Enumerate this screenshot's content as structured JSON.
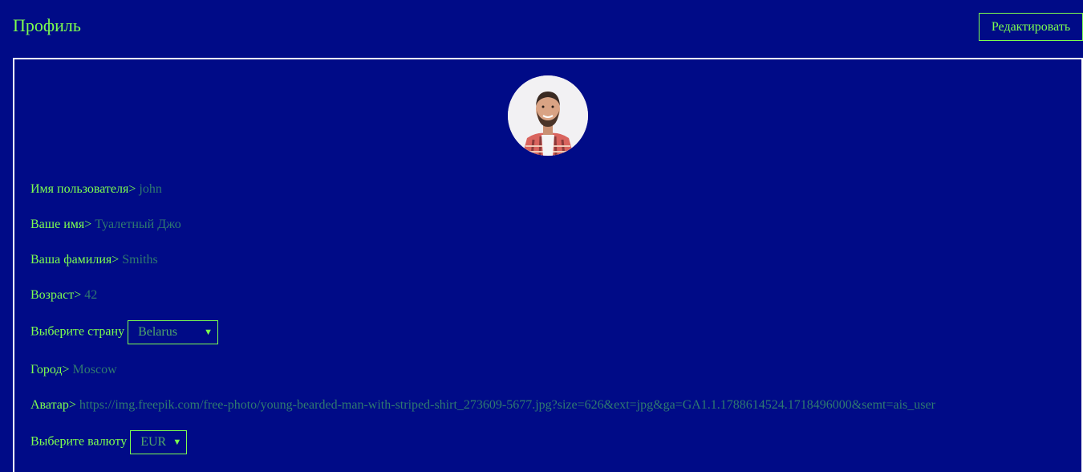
{
  "header": {
    "title": "Профиль",
    "edit_label": "Редактировать"
  },
  "profile": {
    "username_label": "Имя пользователя>",
    "username": "john",
    "firstname_label": "Ваше имя>",
    "firstname": "Туалетный Джо",
    "lastname_label": "Ваша фамилия>",
    "lastname": "Smiths",
    "age_label": "Возраст>",
    "age": "42",
    "country_label": "Выберите страну",
    "country": "Belarus",
    "city_label": "Город>",
    "city": "Moscow",
    "avatar_label": "Аватар>",
    "avatar_url": "https://img.freepik.com/free-photo/young-bearded-man-with-striped-shirt_273609-5677.jpg?size=626&ext=jpg&ga=GA1.1.1788614524.1718496000&semt=ais_user",
    "currency_label": "Выберите валюту",
    "currency": "EUR"
  },
  "colors": {
    "background": "#000b87",
    "accent": "#7cff4f",
    "value_text": "#2f7a6f",
    "card_border": "#ffffff"
  },
  "icons": {
    "select_arrow": "chevron-down-icon"
  }
}
